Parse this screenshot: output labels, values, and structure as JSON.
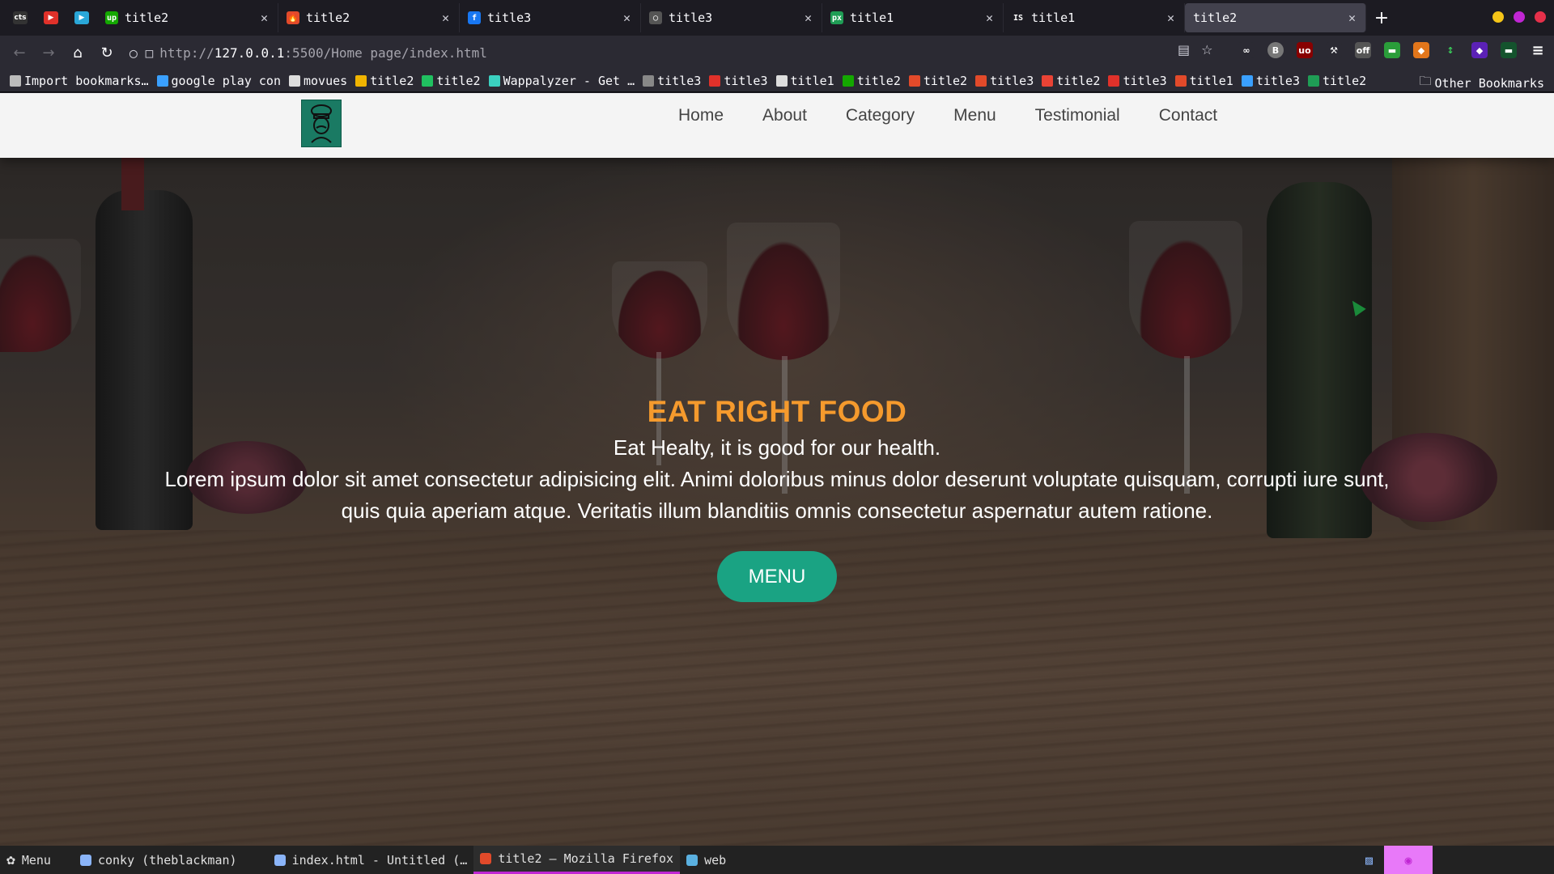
{
  "browser": {
    "pinned_tabs": [
      {
        "name": "cts-pinned",
        "glyph": "cts",
        "color": "#333333"
      },
      {
        "name": "youtube-pinned",
        "glyph": "▶",
        "color": "#e0312a"
      },
      {
        "name": "play-pinned",
        "glyph": "▶",
        "color": "#2aa7d8"
      }
    ],
    "tabs": [
      {
        "title": "title2",
        "icon": "upwork-icon",
        "color": "#14a800",
        "glyph": "up",
        "active": false
      },
      {
        "title": "title2",
        "icon": "flame-icon",
        "color": "#e24a2a",
        "glyph": "🔥",
        "active": false
      },
      {
        "title": "title3",
        "icon": "facebook-icon",
        "color": "#1877f2",
        "glyph": "f",
        "active": false
      },
      {
        "title": "title3",
        "icon": "github-icon",
        "color": "#555555",
        "glyph": "◯",
        "active": false
      },
      {
        "title": "title1",
        "icon": "px-icon",
        "color": "#1f9d55",
        "glyph": "px",
        "active": false
      },
      {
        "title": "title1",
        "icon": "is-icon",
        "color": "#1c1b22",
        "glyph": "IS",
        "active": false
      },
      {
        "title": "title2",
        "icon": "none",
        "color": "#42414d",
        "glyph": "",
        "active": true
      }
    ],
    "window_dot_colors": [
      "#f5c518",
      "#c026d3",
      "#e5304a"
    ],
    "url": {
      "scheme": "http://",
      "host": "127.0.0.1",
      "path": ":5500/Home page/index.html"
    },
    "bookmarks": [
      {
        "label": "Import bookmarks…",
        "color": "#bbbbbb"
      },
      {
        "label": "google play con",
        "color": "#3aa0ff"
      },
      {
        "label": "movues",
        "color": "#dddddd"
      },
      {
        "label": "title2",
        "color": "#f0b400"
      },
      {
        "label": "title2",
        "color": "#20c060"
      },
      {
        "label": "Wappalyzer - Get …",
        "color": "#3bd0c0"
      },
      {
        "label": "title3",
        "color": "#888888"
      },
      {
        "label": "title3",
        "color": "#e0312a"
      },
      {
        "label": "title1",
        "color": "#dddddd"
      },
      {
        "label": "title2",
        "color": "#14a800"
      },
      {
        "label": "title2",
        "color": "#e24a2a"
      },
      {
        "label": "title3",
        "color": "#e24a2a"
      },
      {
        "label": "title2",
        "color": "#ea4335"
      },
      {
        "label": "title3",
        "color": "#e0312a"
      },
      {
        "label": "title1",
        "color": "#e24a2a"
      },
      {
        "label": "title3",
        "color": "#3aa0ff"
      },
      {
        "label": "title2",
        "color": "#1f9d55"
      }
    ],
    "other_bookmarks": "Other Bookmarks"
  },
  "site": {
    "nav": [
      "Home",
      "About",
      "Category",
      "Menu",
      "Testimonial",
      "Contact"
    ],
    "hero": {
      "title": "EAT RIGHT FOOD",
      "subtitle": "Eat Healty, it is good for our health.",
      "lorem": "Lorem ipsum dolor sit amet consectetur adipisicing elit. Animi doloribus minus dolor deserunt voluptate quisquam, corrupti iure sunt, quis quia aperiam atque. Veritatis illum blanditiis omnis consectetur aspernatur autem ratione.",
      "button": "MENU"
    },
    "colors": {
      "accent_orange": "#f59a2d",
      "button_teal": "#1aa383",
      "logo_green": "#1a7a63"
    }
  },
  "taskbar": {
    "start_label": "Menu",
    "items": [
      {
        "label": "conky (theblackman)",
        "color": "#8ab4f8",
        "active": false
      },
      {
        "label": "index.html - Untitled (…",
        "color": "#8ab4f8",
        "active": false
      },
      {
        "label": "title2 — Mozilla Firefox",
        "color": "#e24a2a",
        "active": true
      },
      {
        "label": "web",
        "color": "#5ab0e0",
        "active": false
      }
    ]
  }
}
